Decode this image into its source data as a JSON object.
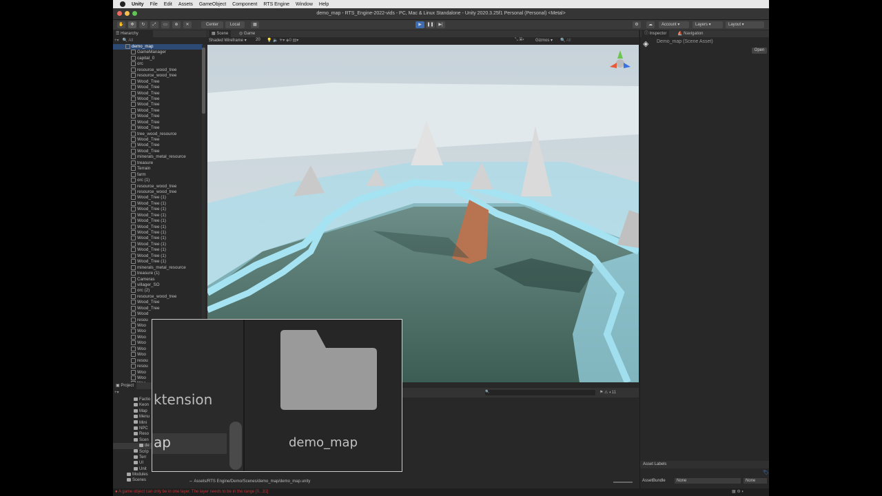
{
  "mac_menu": [
    "Unity",
    "File",
    "Edit",
    "Assets",
    "GameObject",
    "Component",
    "RTS Engine",
    "Window",
    "Help"
  ],
  "window_title": "demo_map - RTS_Engine-2022-vids - PC, Mac & Linux Standalone - Unity 2020.3.25f1 Personal (Personal) <Metal>",
  "toolbar": {
    "center": "Center",
    "local": "Local",
    "account": "Account",
    "layers": "Layers",
    "layout": "Layout"
  },
  "hierarchy": {
    "tab": "Hierarchy",
    "search_placeholder": "All",
    "root": "demo_map",
    "items": [
      "GameManager",
      "capital_0",
      "orc",
      "resource_wood_tree",
      "resource_wood_tree",
      "Wood_Tree",
      "Wood_Tree",
      "Wood_Tree",
      "Wood_Tree",
      "Wood_Tree",
      "Wood_Tree",
      "Wood_Tree",
      "Wood_Tree",
      "Wood_Tree",
      "tree_wood_resource",
      "Wood_Tree",
      "Wood_Tree",
      "Wood_Tree",
      "minerals_metal_resource",
      "treasure",
      "Terrain",
      "farm",
      "orc (1)",
      "resource_wood_tree",
      "resource_wood_tree",
      "Wood_Tree (1)",
      "Wood_Tree (1)",
      "Wood_Tree (1)",
      "Wood_Tree (1)",
      "Wood_Tree (1)",
      "Wood_Tree (1)",
      "Wood_Tree (1)",
      "Wood_Tree (1)",
      "Wood_Tree (1)",
      "Wood_Tree (1)",
      "Wood_Tree (1)",
      "Wood_Tree (1)",
      "minerals_metal_resource",
      "treasure (1)",
      "Cameras",
      "villager_SO",
      "orc (2)",
      "resource_wood_tree",
      "Wood_Tree",
      "Wood_Tree",
      "Wood",
      "resou",
      "Woo",
      "Woo",
      "Woo",
      "Woo",
      "Woo",
      "Woo",
      "resou",
      "resou",
      "Woo",
      "Woo",
      "Woo"
    ]
  },
  "scene": {
    "tab_scene": "Scene",
    "tab_game": "Game",
    "draw_mode": "Shaded Wireframe",
    "scale": "20",
    "gizmos": "Gizmos",
    "all": "All"
  },
  "inspector": {
    "tab": "Inspector",
    "tab2": "Navigation",
    "asset_name": "Demo_map (Scene Asset)",
    "open_button": "Open",
    "asset_labels": "Asset Labels",
    "asset_bundle": "AssetBundle",
    "none1": "None",
    "none2": "None"
  },
  "project": {
    "tab": "Project",
    "folders": [
      "Factio",
      "Keon",
      "Map",
      "Menu",
      "Mini",
      "NPC",
      "Reso",
      "Scen",
      "de",
      "Scrip",
      "Terr",
      "UI",
      "Unit",
      "Modules",
      "Scenes"
    ],
    "path": "Assets/RTS Engine/Demo/Scenes/demo_map/demo_map.unity"
  },
  "popup": {
    "left_text_1": "ktension",
    "left_text_2": "ap",
    "folder_label": "demo_map"
  },
  "status": {
    "error": "A game object can only be in one layer. The layer needs to be in the range [0...31]"
  },
  "colors": {
    "accent": "#3d6cb3",
    "selection": "#2c4a73",
    "sky": "#c9d5dc",
    "water": "#9fdcec",
    "ground": "#3f6358"
  }
}
